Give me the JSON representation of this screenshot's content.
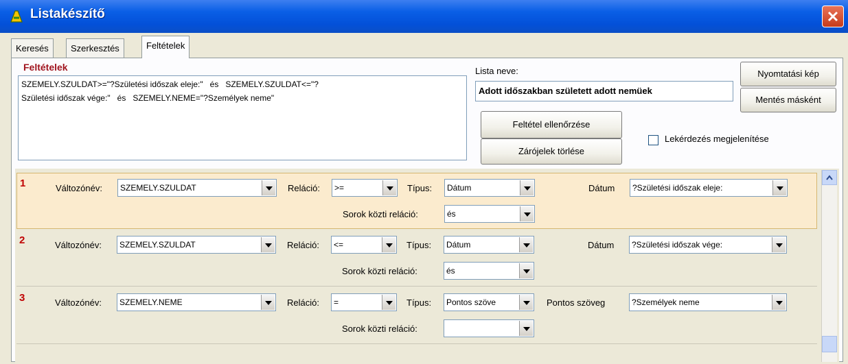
{
  "window": {
    "title": "Listakészítő"
  },
  "tabs": [
    {
      "label": "Keresés"
    },
    {
      "label": "Szerkesztés"
    },
    {
      "label": "Feltételek"
    }
  ],
  "criteria": {
    "group_title": "Feltételek",
    "text": "SZEMELY.SZULDAT>=\"?Születési időszak eleje:\"   és   SZEMELY.SZULDAT<=\"?\nSzületési időszak vége:\"   és   SZEMELY.NEME=\"?Személyek neme\""
  },
  "list_name": {
    "label": "Lista neve:",
    "value": "Adott időszakban született adott nemüek"
  },
  "buttons": {
    "print_preview": "Nyomtatási kép",
    "save_as": "Mentés másként",
    "check_condition": "Feltétel ellenőrzése",
    "clear_brackets": "Zárójelek törlése"
  },
  "show_query": {
    "label": "Lekérdezés megjelenítése",
    "checked": false
  },
  "field_labels": {
    "variable": "Változónév:",
    "relation": "Reláció:",
    "type": "Típus:",
    "row_relation": "Sorok közti reláció:"
  },
  "rows": [
    {
      "num": "1",
      "variable": "SZEMELY.SZULDAT",
      "relation": ">=",
      "type": "Dátum",
      "value_label": "Dátum",
      "value": "?Születési időszak eleje:",
      "row_relation": "és"
    },
    {
      "num": "2",
      "variable": "SZEMELY.SZULDAT",
      "relation": "<=",
      "type": "Dátum",
      "value_label": "Dátum",
      "value": "?Születési időszak vége:",
      "row_relation": "és"
    },
    {
      "num": "3",
      "variable": "SZEMELY.NEME",
      "relation": "=",
      "type": "Pontos szöve",
      "value_label": "Pontos szöveg",
      "value": "?Személyek neme",
      "row_relation": ""
    }
  ]
}
